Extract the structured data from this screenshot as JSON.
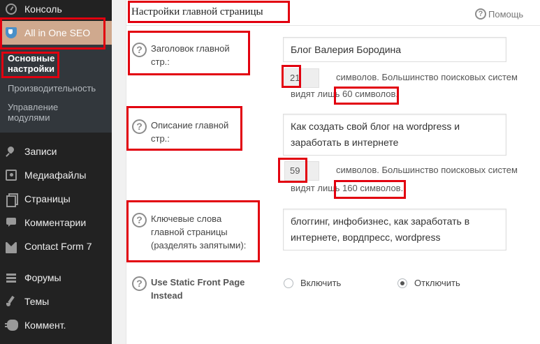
{
  "sidebar": {
    "console": "Консоль",
    "aioseo": "All in One SEO",
    "submenu": {
      "general": "Основные настройки",
      "performance": "Производительность",
      "modules": "Управление модулями"
    },
    "posts": "Записи",
    "media": "Медиафайлы",
    "pages": "Страницы",
    "comments": "Комментарии",
    "contact_form": "Contact Form 7",
    "forums": "Форумы",
    "themes": "Темы",
    "comment_short": "Коммент."
  },
  "panel": {
    "title": "Настройки главной страницы",
    "help": "Помощь"
  },
  "fields": {
    "home_title": {
      "label": "Заголовок главной стр.:",
      "value": "Блог Валерия Бородина",
      "count": "21",
      "note_line1": "символов. Большинство поисковых систем",
      "note_line2": "видят лишь 60 символов."
    },
    "home_description": {
      "label": "Описание главной стр.:",
      "value": "Как создать свой блог на wordpress и заработать в интернете",
      "count": "59",
      "note_line1": "символов. Большинство поисковых систем",
      "note_line2": "видят лишь 160 символов."
    },
    "home_keywords": {
      "label": "Ключевые слова главной страницы (разделять запятыми):",
      "value": "блоггинг, инфобизнес, как заработать в интернете, вордпресс, wordpress"
    },
    "static_front": {
      "label": "Use Static Front Page Instead",
      "option_on": "Включить",
      "option_off": "Отключить",
      "selected": "Отключить"
    }
  },
  "colors": {
    "sidebar_bg": "#222222",
    "active_menu": "#cfa98e",
    "annotation_red": "#e2000f"
  }
}
